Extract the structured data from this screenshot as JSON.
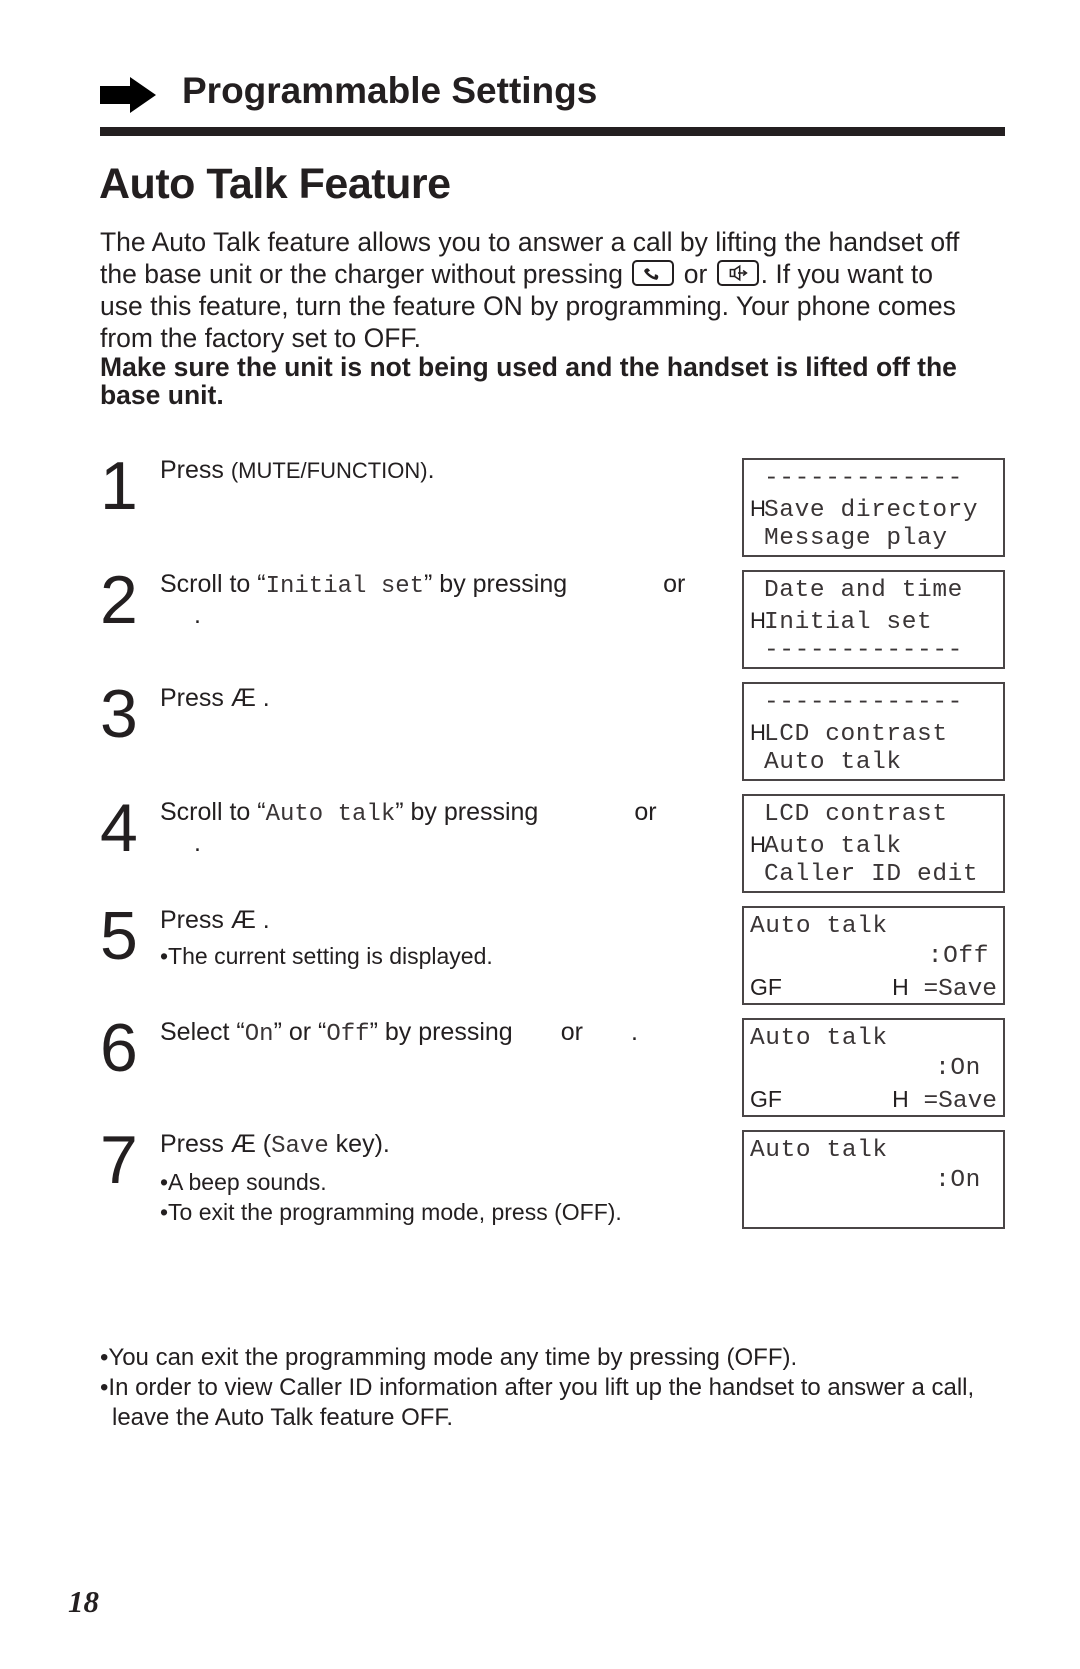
{
  "header": {
    "section_title": "Programmable Settings",
    "arrow_icon": "right-arrow-icon"
  },
  "page_title": "Auto Talk Feature",
  "intro": {
    "line1": "The Auto Talk feature allows you to answer a call by lifting the handset off",
    "line2_before": "the base unit or the charger without pressing",
    "line2_or": "or",
    "line2_after": ". If you want to",
    "line3": "use this feature, turn the feature ON by programming. Your phone comes",
    "line4": "from the factory set to OFF.",
    "warning_line1": "Make sure the unit is not being used and the handset is lifted off the",
    "warning_line2": "base unit.",
    "icons": [
      "talk-button-icon",
      "speaker-button-icon"
    ]
  },
  "steps": [
    {
      "number": "1",
      "prefix": "Press ",
      "key": "(MUTE/FUNCTION)",
      "suffix": "."
    },
    {
      "number": "2",
      "prefix": "Scroll to “",
      "mono": "Initial set",
      "mid": "” by pressing",
      "or": "or",
      "end": "."
    },
    {
      "number": "3",
      "prefix": "Press Æ ",
      "suffix": "."
    },
    {
      "number": "4",
      "prefix": "Scroll to “",
      "mono": "Auto talk",
      "mid": "” by pressing",
      "or": "or",
      "end": "."
    },
    {
      "number": "5",
      "prefix": "Press Æ ",
      "suffix": ".",
      "notes": [
        "•The current setting is displayed."
      ]
    },
    {
      "number": "6",
      "prefix": "Select “",
      "mono1": "On",
      "mid1": "” or “",
      "mono2": "Off",
      "mid2": "” by pressing",
      "or": "or",
      "end": "."
    },
    {
      "number": "7",
      "prefix": "Press Æ  (",
      "mono": "Save",
      "suffix": " key).",
      "notes": [
        "•A beep sounds.",
        "•To exit the programming mode, press (OFF)."
      ]
    }
  ],
  "lcd_screens": [
    {
      "lines": [
        "-------------",
        "Save directory",
        "Message play"
      ],
      "cursor_line": 1,
      "cursor": "H"
    },
    {
      "lines": [
        "Date and time",
        "Initial set",
        "-------------"
      ],
      "cursor_line": 1,
      "cursor": "H"
    },
    {
      "lines": [
        "-------------",
        "LCD contrast",
        "Auto talk"
      ],
      "cursor_line": 1,
      "cursor": "H"
    },
    {
      "lines": [
        "LCD contrast",
        "Auto talk",
        "Caller ID edit"
      ],
      "cursor_line": 1,
      "cursor": "H"
    },
    {
      "title": "Auto talk",
      "value": ":Off",
      "indicator": "GF",
      "save_key": "H",
      "save_label": " =Save"
    },
    {
      "title": "Auto talk",
      "value": ":On",
      "indicator": "GF",
      "save_key": "H",
      "save_label": " =Save"
    },
    {
      "title": "Auto talk",
      "value": ":On"
    }
  ],
  "notes": [
    "•You can exit the programming mode any time by pressing (OFF).",
    "•In order to view Caller ID information after you lift up the handset to answer a call,",
    "leave the Auto Talk feature OFF."
  ],
  "page_number": "18"
}
